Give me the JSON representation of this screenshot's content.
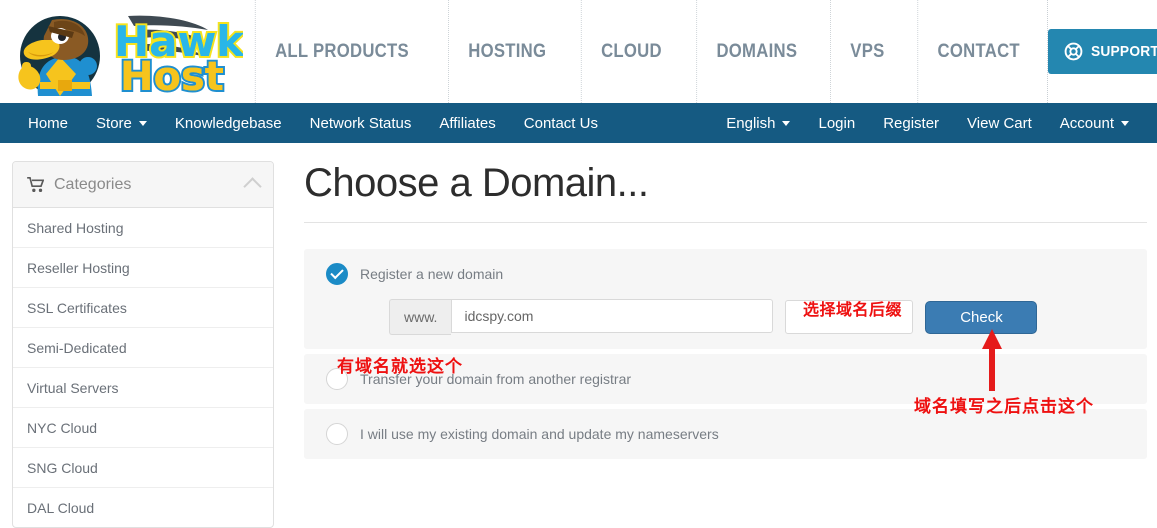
{
  "brand": {
    "logo_text_top": "Hawk",
    "logo_text_bottom": "Host",
    "logo_alt": "hawk-host-logo"
  },
  "top_nav": {
    "items": [
      {
        "label": "ALL PRODUCTS",
        "name": "all-products"
      },
      {
        "label": "HOSTING",
        "name": "hosting"
      },
      {
        "label": "CLOUD",
        "name": "cloud"
      },
      {
        "label": "DOMAINS",
        "name": "domains"
      },
      {
        "label": "VPS",
        "name": "vps"
      },
      {
        "label": "CONTACT",
        "name": "contact"
      }
    ],
    "support_button": {
      "label": "SUPPORT AND CLIENT AREA",
      "icon": "lifebuoy-icon",
      "color": "#2487b0"
    }
  },
  "navbar": {
    "background": "#155a82",
    "left_items": [
      {
        "label": "Home",
        "caret": false
      },
      {
        "label": "Store",
        "caret": true
      },
      {
        "label": "Knowledgebase",
        "caret": false
      },
      {
        "label": "Network Status",
        "caret": false
      },
      {
        "label": "Affiliates",
        "caret": false
      },
      {
        "label": "Contact Us",
        "caret": false
      }
    ],
    "right_items": [
      {
        "label": "English",
        "caret": true
      },
      {
        "label": "Login",
        "caret": false
      },
      {
        "label": "Register",
        "caret": false
      },
      {
        "label": "View Cart",
        "caret": false
      },
      {
        "label": "Account",
        "caret": true
      }
    ]
  },
  "sidebar": {
    "header": {
      "title": "Categories",
      "icon": "shopping-cart-icon",
      "collapse_icon": "chevron-up-icon"
    },
    "items": [
      {
        "label": "Shared Hosting"
      },
      {
        "label": "Reseller Hosting"
      },
      {
        "label": "SSL Certificates"
      },
      {
        "label": "Semi-Dedicated"
      },
      {
        "label": "Virtual Servers"
      },
      {
        "label": "NYC Cloud"
      },
      {
        "label": "SNG Cloud"
      },
      {
        "label": "DAL Cloud"
      }
    ]
  },
  "main": {
    "page_title": "Choose a Domain...",
    "options": [
      {
        "label": "Register a new domain",
        "selected": true,
        "name": "register-new-domain"
      },
      {
        "label": "Transfer your domain from another registrar",
        "selected": false,
        "name": "transfer-domain"
      },
      {
        "label": "I will use my existing domain and update my nameservers",
        "selected": false,
        "name": "use-existing-domain"
      }
    ],
    "domain_form": {
      "prefix_addon": "www.",
      "domain_value": "idcspy.com",
      "domain_placeholder": "",
      "tld_value": "",
      "check_button": "Check",
      "check_button_color": "#3b7cb3"
    }
  },
  "annotations": {
    "color": "#ee1111",
    "tld_note": "选择域名后缀",
    "transfer_note": "有域名就选这个",
    "check_note": "域名填写之后点击这个",
    "arrow": "red-up-arrow"
  }
}
